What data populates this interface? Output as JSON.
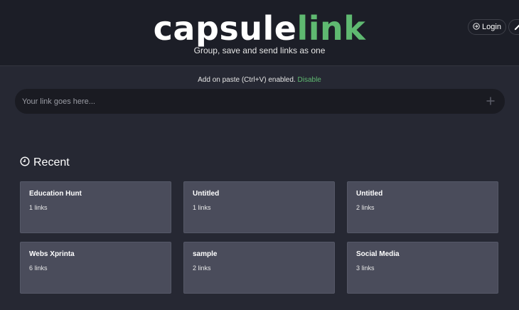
{
  "header": {
    "logo_part1": "capsule",
    "logo_part2": "link",
    "tagline": "Group, save and send links as one",
    "login_label": "Login"
  },
  "paste_notice": {
    "text": "Add on paste (Ctrl+V) enabled.",
    "action": "Disable"
  },
  "link_input": {
    "placeholder": "Your link goes here...",
    "value": ""
  },
  "recent": {
    "title": "Recent",
    "cards": [
      {
        "title": "Education Hunt",
        "count": "1 links"
      },
      {
        "title": "Untitled",
        "count": "1 links"
      },
      {
        "title": "Untitled",
        "count": "2 links"
      },
      {
        "title": "Webs Xprinta",
        "count": "6 links"
      },
      {
        "title": "sample",
        "count": "2 links"
      },
      {
        "title": "Social Media",
        "count": "3 links"
      }
    ]
  },
  "colors": {
    "brand_green": "#5fb971",
    "background": "#262833",
    "header_bg": "#1c1e27",
    "card_bg": "#4a4c5b"
  },
  "icons": {
    "login": "login-arrow-icon",
    "edit": "pencil-icon",
    "add": "plus-icon",
    "recent": "clock-icon"
  }
}
